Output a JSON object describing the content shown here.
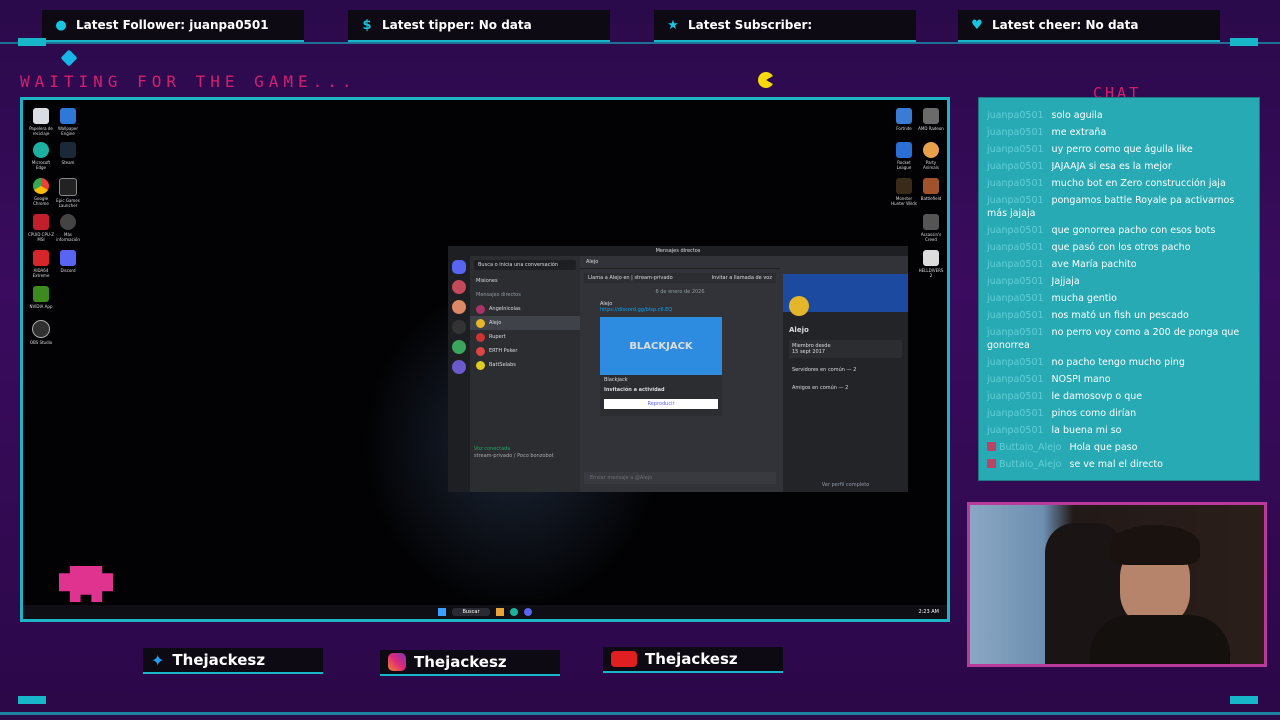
{
  "alerts": [
    {
      "icon": "follower-icon",
      "glyph": "●",
      "label": "Latest Follower: juanpa0501"
    },
    {
      "icon": "dollar-icon",
      "glyph": "$",
      "label": "Latest tipper: No data"
    },
    {
      "icon": "star-icon",
      "glyph": "★",
      "label": "Latest Subscriber:"
    },
    {
      "icon": "heart-icon",
      "glyph": "♥",
      "label": "Latest cheer: No data"
    }
  ],
  "waiting_text": "WAITING FOR THE GAME...",
  "chat_title": "CHAT",
  "chat": [
    {
      "user": "juanpa0501",
      "text": "solo aguila"
    },
    {
      "user": "juanpa0501",
      "text": "me extraña"
    },
    {
      "user": "juanpa0501",
      "text": "uy perro como que águila like"
    },
    {
      "user": "juanpa0501",
      "text": "JAJAAJA si esa es la mejor"
    },
    {
      "user": "juanpa0501",
      "text": "mucho bot en Zero construcción jaja"
    },
    {
      "user": "juanpa0501",
      "text": "pongamos battle Royale pa activarnos más jajaja"
    },
    {
      "user": "juanpa0501",
      "text": "que gonorrea pacho con esos bots"
    },
    {
      "user": "juanpa0501",
      "text": "que pasó con los otros pacho"
    },
    {
      "user": "juanpa0501",
      "text": "ave María pachito"
    },
    {
      "user": "juanpa0501",
      "text": "Jajjaja"
    },
    {
      "user": "juanpa0501",
      "text": "mucha gentio"
    },
    {
      "user": "juanpa0501",
      "text": "nos mató un fish un pescado"
    },
    {
      "user": "juanpa0501",
      "text": "no perro voy como a 200 de ponga que gonorrea"
    },
    {
      "user": "juanpa0501",
      "text": "no pacho tengo mucho ping"
    },
    {
      "user": "juanpa0501",
      "text": "NOSPI mano"
    },
    {
      "user": "juanpa0501",
      "text": "le damosovp o que"
    },
    {
      "user": "juanpa0501",
      "text": "pinos como dirían"
    },
    {
      "user": "juanpa0501",
      "text": "la buena mi so"
    },
    {
      "user": "Buttalo_Alejo",
      "text": "Hola que paso"
    },
    {
      "user": "Buttalo_Alejo",
      "text": "se ve mal el directo"
    }
  ],
  "socials": [
    {
      "icon": "twitter-icon",
      "handle": "Thejackesz"
    },
    {
      "icon": "instagram-icon",
      "handle": "Thejackesz"
    },
    {
      "icon": "youtube-icon",
      "handle": "Thejackesz"
    }
  ],
  "desktop_icons": [
    "Papelera de reciclaje",
    "Wallpaper Engine",
    "Microsoft Edge",
    "Steam",
    "Google Chrome",
    "Epic Games Launcher",
    "CPUID CPU-Z MSI",
    "Más información",
    "AIDA64 Extreme",
    "Discord",
    "NVIDIA App",
    "OBS Studio"
  ],
  "desktop_icons_right": [
    "Fortnite",
    "AMD Radeon",
    "Rocket League",
    "Party Animals",
    "Monster Hunter Wilds",
    "Battlefield",
    "Assassin's Creed",
    "HELLDIVERS 2"
  ],
  "taskbar_search": "Buscar",
  "taskbar_time": "2:23 AM",
  "discord": {
    "title": "Mensajes directos",
    "search_placeholder": "Busca o inicia una conversación",
    "missions": "Misiones",
    "dm_header": "Mensajes directos",
    "dms": [
      "Angelnicolas",
      "Alejo",
      "Rupert",
      "ERTH Poker",
      "BattSelabs"
    ],
    "channel_user": "Alejo",
    "call_banner": "Llama a Alejo en | stream-privado",
    "call_button": "Invitar a llamada de voz",
    "date_divider": "6 de enero de 2026",
    "msg_user": "Alejo",
    "msg_link": "https://discord.gg/blsp.c6.EQ",
    "card_title": "BLACKJACK",
    "card_players": "2-8 PLAYERS",
    "card_game": "Blackjack",
    "card_invite": "Invitación a actividad",
    "card_button": "Reproducir",
    "composer_placeholder": "Enviar mensaje a @Alejo",
    "voice_status": "Voz conectada",
    "voice_channel": "stream-privado / Poco bonzobot",
    "profile_name": "Alejo",
    "member_since_label": "Miembro desde",
    "member_since": "15 sept 2017",
    "servers_common": "Servidores en común — 2",
    "friends_common": "Amigos en común — 2",
    "full_profile": "Ver perfil completo"
  }
}
